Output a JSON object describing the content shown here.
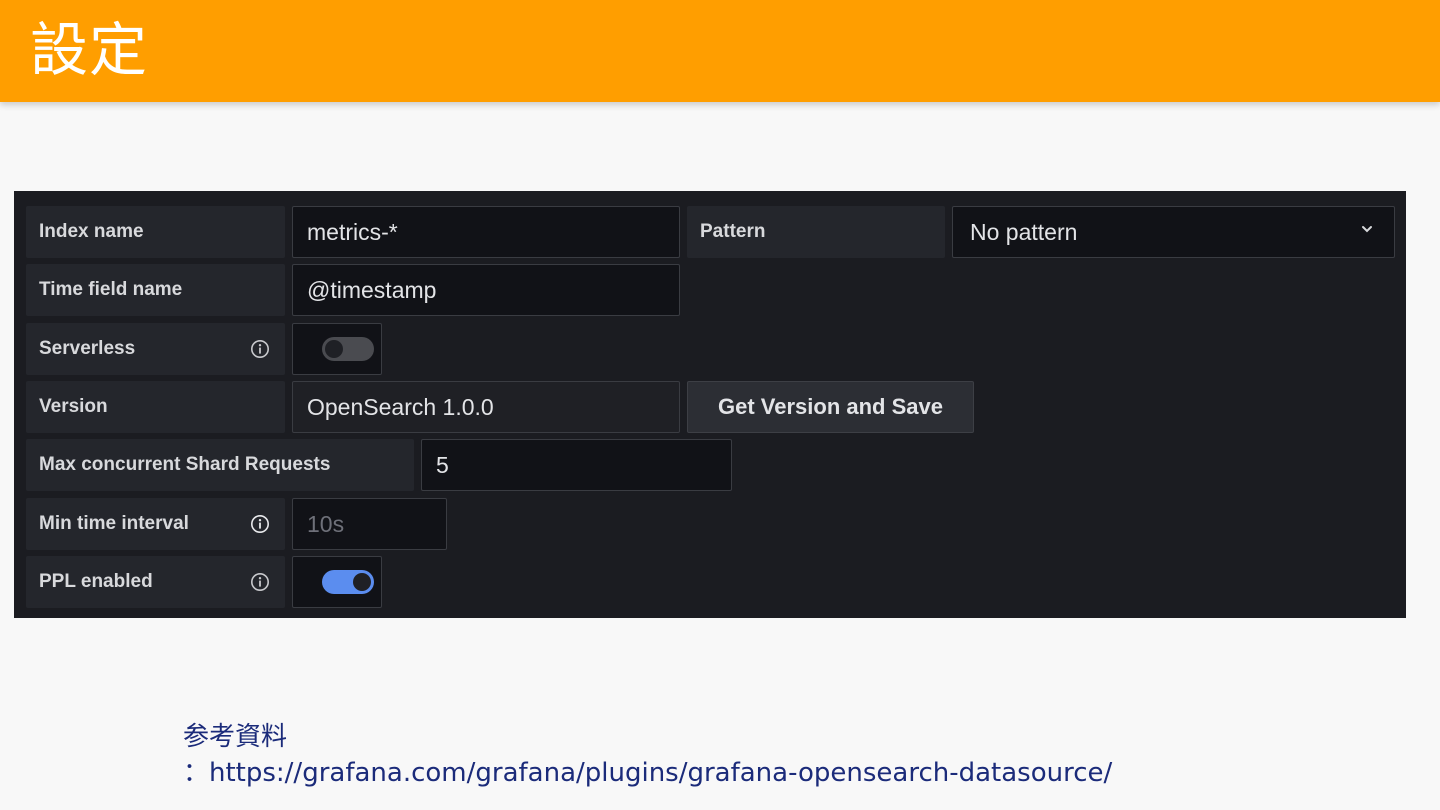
{
  "header": {
    "title": "設定"
  },
  "form": {
    "index_name": {
      "label": "Index name",
      "value": "metrics-*"
    },
    "pattern": {
      "label": "Pattern",
      "value": "No pattern"
    },
    "time_field": {
      "label": "Time field name",
      "value": "@timestamp"
    },
    "serverless": {
      "label": "Serverless",
      "enabled": false
    },
    "version": {
      "label": "Version",
      "value": "OpenSearch 1.0.0",
      "button": "Get Version and Save"
    },
    "max_shard": {
      "label": "Max concurrent Shard Requests",
      "value": "5"
    },
    "min_interval": {
      "label": "Min time interval",
      "placeholder": "10s"
    },
    "ppl": {
      "label": "PPL enabled",
      "enabled": true
    }
  },
  "reference": {
    "title": "参考資料",
    "url": "：https://grafana.com/grafana/plugins/grafana-opensearch-datasource/"
  },
  "colors": {
    "header_bg": "#ff9e00",
    "panel_bg": "#1b1c21",
    "toggle_on": "#5b8def",
    "toggle_off": "#4a4b50",
    "link_text": "#1b2b7a"
  }
}
